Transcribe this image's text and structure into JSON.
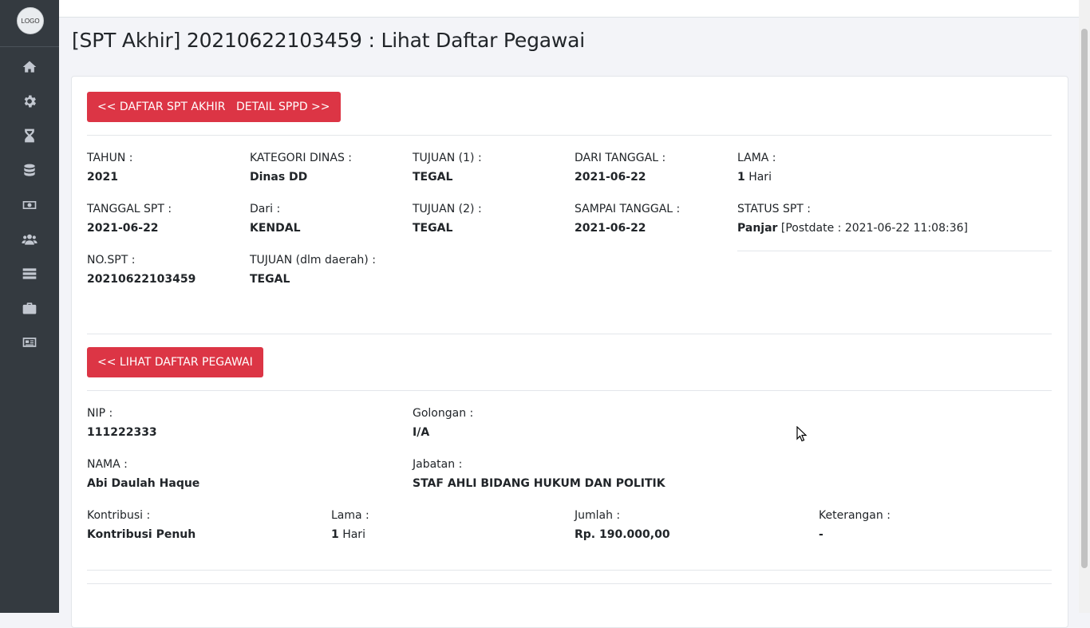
{
  "sidebar": {
    "logo_text": "LOGO",
    "items": [
      {
        "icon": "home-icon"
      },
      {
        "icon": "gear-icon"
      },
      {
        "icon": "hourglass-icon"
      },
      {
        "icon": "database-icon"
      },
      {
        "icon": "money-icon"
      },
      {
        "icon": "users-icon"
      },
      {
        "icon": "server-icon"
      },
      {
        "icon": "briefcase-icon"
      },
      {
        "icon": "newspaper-icon"
      }
    ]
  },
  "page_title": "[SPT Akhir] 20210622103459 : Lihat Daftar Pegawai",
  "buttons": {
    "daftar_spt_akhir": "<< DAFTAR SPT AKHIR",
    "detail_sppd": "DETAIL SPPD >>",
    "lihat_daftar_pegawai": "<< LIHAT DAFTAR PEGAWAI"
  },
  "spt": {
    "tahun": {
      "label": "TAHUN :",
      "value": "2021"
    },
    "kategori_dinas": {
      "label": "KATEGORI DINAS :",
      "value": "Dinas DD"
    },
    "tujuan1": {
      "label": "TUJUAN (1) :",
      "value": "TEGAL"
    },
    "dari_tanggal": {
      "label": "DARI TANGGAL :",
      "value": "2021-06-22"
    },
    "lama": {
      "label": "LAMA :",
      "value": "1",
      "unit": " Hari"
    },
    "tanggal_spt": {
      "label": "TANGGAL SPT :",
      "value": "2021-06-22"
    },
    "dari": {
      "label": "Dari :",
      "value": "KENDAL"
    },
    "tujuan2": {
      "label": "TUJUAN (2) :",
      "value": "TEGAL"
    },
    "sampai_tanggal": {
      "label": "SAMPAI TANGGAL :",
      "value": "2021-06-22"
    },
    "status_spt": {
      "label": "STATUS SPT :",
      "value": "Panjar",
      "postdate": " [Postdate : 2021-06-22 11:08:36]"
    },
    "no_spt": {
      "label": "NO.SPT :",
      "value": "20210622103459"
    },
    "tujuan_dlm_daerah": {
      "label": "TUJUAN (dlm daerah) :",
      "value": "TEGAL"
    }
  },
  "pegawai": {
    "nip": {
      "label": "NIP :",
      "value": "111222333"
    },
    "golongan": {
      "label": "Golongan :",
      "value": "I/A"
    },
    "nama": {
      "label": "NAMA :",
      "value": "Abi Daulah Haque"
    },
    "jabatan": {
      "label": "Jabatan :",
      "value": "STAF AHLI BIDANG HUKUM DAN POLITIK"
    },
    "kontribusi": {
      "label": "Kontribusi :",
      "value": "Kontribusi Penuh"
    },
    "lama": {
      "label": "Lama :",
      "value": "1",
      "unit": " Hari"
    },
    "jumlah": {
      "label": "Jumlah :",
      "value": "Rp. 190.000,00"
    },
    "keterangan": {
      "label": "Keterangan :",
      "value": "-"
    }
  },
  "colors": {
    "accent": "#dc3545",
    "sidebar": "#343a40"
  }
}
